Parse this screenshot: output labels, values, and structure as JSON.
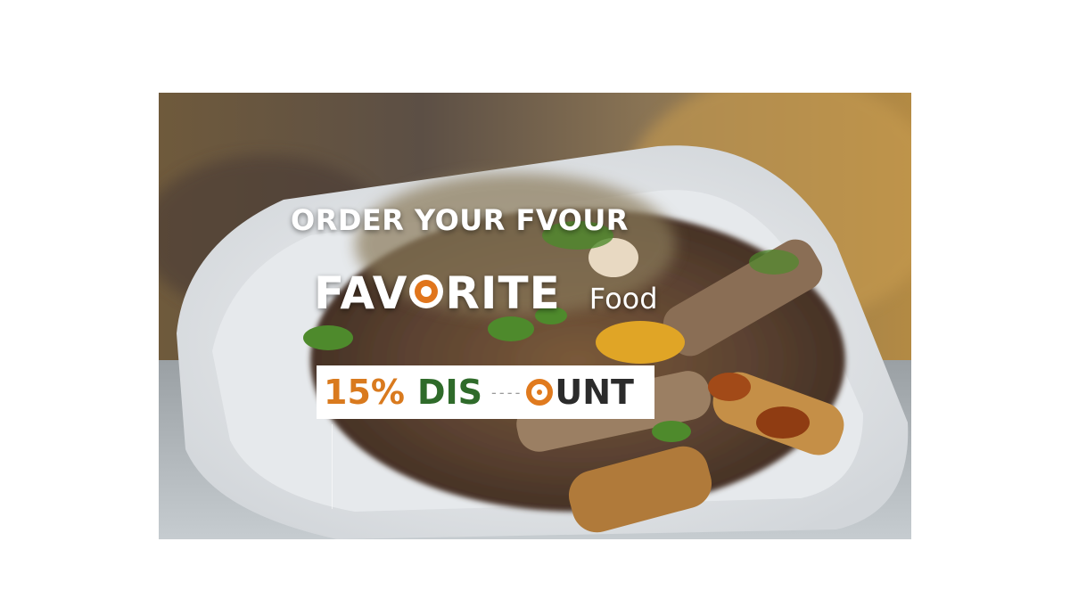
{
  "banner": {
    "headline": "ORDER YOUR FVOUR",
    "title_part1": "FAV",
    "title_part2": "RITE",
    "title_sub": "Food",
    "discount_percent": "15%",
    "discount_word1": "DIS",
    "discount_dash": "- - - -",
    "discount_word2": "UNT"
  },
  "colors": {
    "accent_orange": "#e0751c",
    "accent_green": "#2f6b2a"
  }
}
